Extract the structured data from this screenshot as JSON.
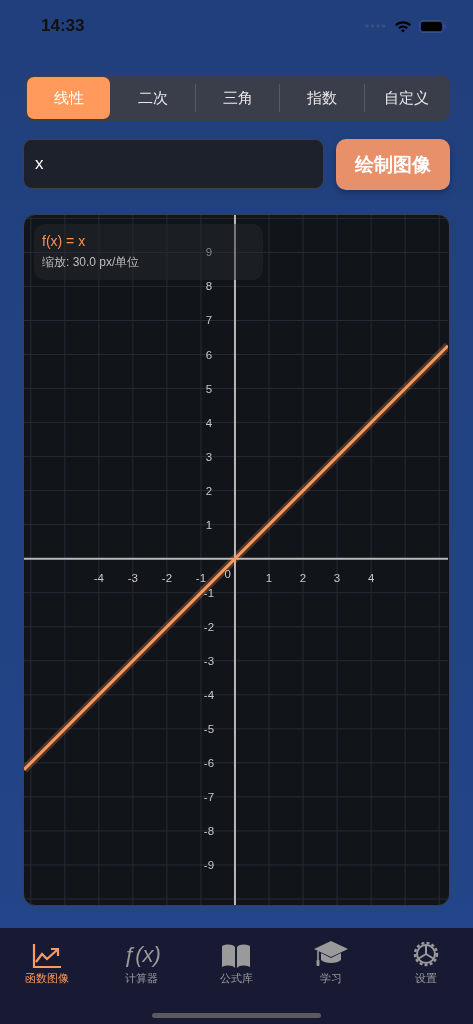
{
  "status_bar": {
    "time": "14:33"
  },
  "segments": [
    {
      "label": "线性",
      "selected": true
    },
    {
      "label": "二次",
      "selected": false
    },
    {
      "label": "三角",
      "selected": false
    },
    {
      "label": "指数",
      "selected": false
    },
    {
      "label": "自定义",
      "selected": false
    }
  ],
  "input": {
    "value": "x"
  },
  "draw_button": "绘制图像",
  "graph": {
    "info": {
      "scale": "缩放: 30.0 px/单位"
    },
    "origin_label": "0",
    "chart_data": {
      "type": "line",
      "x": [
        -6.2,
        6.26
      ],
      "series": [
        {
          "name": "f(x) = x",
          "color": "#ff9a5c",
          "values": [
            -6.2,
            6.26
          ]
        }
      ],
      "xlim": [
        -6.2,
        6.26
      ],
      "ylim": [
        -10.2,
        10.1
      ],
      "grid": true,
      "xticks": [
        -4,
        -3,
        -2,
        -1,
        1,
        2,
        3,
        4
      ],
      "yticks": [
        9,
        8,
        7,
        6,
        5,
        4,
        3,
        2,
        1,
        -1,
        -2,
        -3,
        -4,
        -5,
        -6,
        -7,
        -8,
        -9
      ]
    }
  },
  "tab_bar": [
    {
      "label": "函数图像",
      "selected": true
    },
    {
      "label": "计算器",
      "icon_text": "ƒ(x)",
      "selected": false
    },
    {
      "label": "公式库",
      "selected": false
    },
    {
      "label": "学习",
      "selected": false
    },
    {
      "label": "设置",
      "selected": false
    }
  ]
}
